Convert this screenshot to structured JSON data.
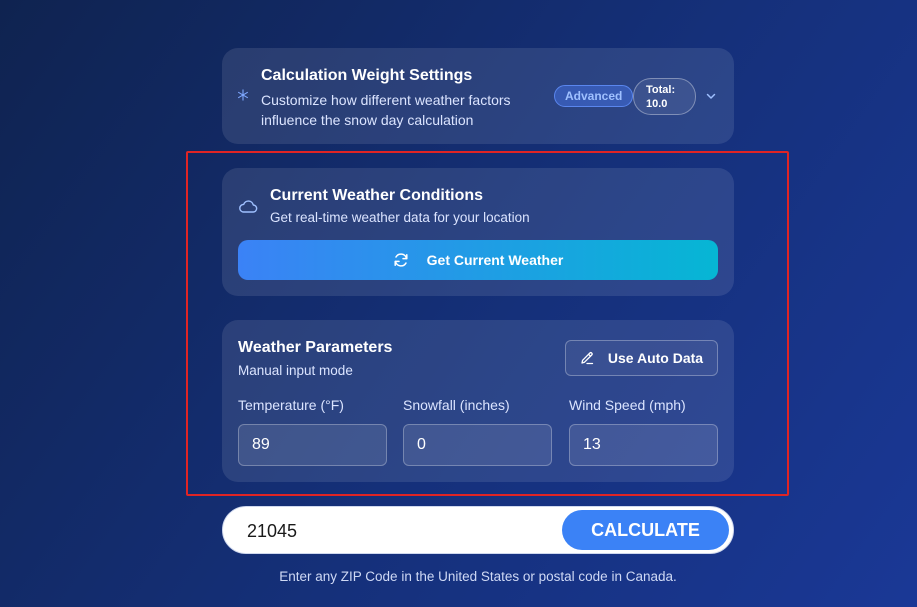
{
  "weights_card": {
    "title": "Calculation Weight Settings",
    "description": "Customize how different weather factors influence the snow day calculation",
    "advanced_badge": "Advanced",
    "total_label": "Total:",
    "total_value": "10.0",
    "icons": {
      "settings": "snowflake-icon",
      "toggle": "chevron-down-icon"
    }
  },
  "current_weather": {
    "title": "Current Weather Conditions",
    "subtitle": "Get real-time weather data for your location",
    "button_label": "Get Current Weather",
    "icons": {
      "header": "cloud-icon",
      "button": "refresh-icon"
    }
  },
  "parameters": {
    "title": "Weather Parameters",
    "mode": "Manual input mode",
    "auto_button": "Use Auto Data",
    "fields": [
      {
        "label": "Temperature (°F)",
        "value": "89"
      },
      {
        "label": "Snowfall (inches)",
        "value": "0"
      },
      {
        "label": "Wind Speed (mph)",
        "value": "13"
      }
    ]
  },
  "zip": {
    "value": "21045",
    "button_label": "CALCULATE",
    "hint": "Enter any ZIP Code in the United States or postal code in Canada."
  },
  "colors": {
    "accent": "#3b82f6",
    "gradient_end": "#06b6d4",
    "highlight": "#e02424"
  }
}
